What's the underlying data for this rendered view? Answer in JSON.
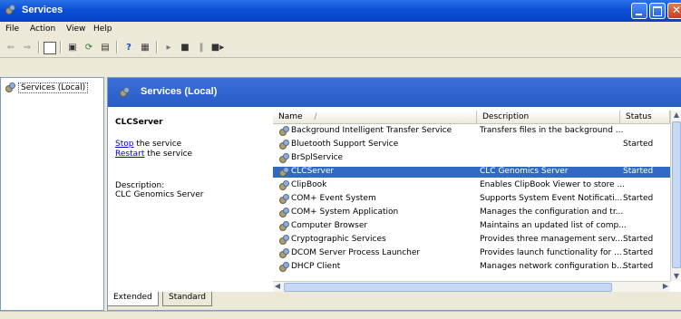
{
  "window": {
    "title": "Services"
  },
  "menu": [
    "File",
    "Action",
    "View",
    "Help"
  ],
  "toolbar": {
    "icons": [
      "back-icon",
      "forward-icon",
      "show-hide-tree-icon",
      "properties-icon",
      "refresh-icon",
      "export-list-icon",
      "help-icon",
      "console-icon",
      "start-icon",
      "stop-icon",
      "pause-icon",
      "restart-icon"
    ]
  },
  "tree": {
    "root": "Services (Local)"
  },
  "header": {
    "title": "Services (Local)"
  },
  "detail": {
    "service_name": "CLCServer",
    "stop_link": "Stop",
    "stop_suffix": " the service",
    "restart_link": "Restart",
    "restart_suffix": " the service",
    "description_label": "Description:",
    "description_text": "CLC Genomics Server"
  },
  "columns": {
    "name": "Name",
    "sort": "/",
    "description": "Description",
    "status": "Status"
  },
  "services": [
    {
      "name": "Background Intelligent Transfer Service",
      "description": "Transfers files in the background ...",
      "status": "",
      "selected": false
    },
    {
      "name": "Bluetooth Support Service",
      "description": "",
      "status": "Started",
      "selected": false
    },
    {
      "name": "BrSplService",
      "description": "",
      "status": "",
      "selected": false
    },
    {
      "name": "CLCServer",
      "description": "CLC Genomics Server",
      "status": "Started",
      "selected": true
    },
    {
      "name": "ClipBook",
      "description": "Enables ClipBook Viewer to store ...",
      "status": "",
      "selected": false
    },
    {
      "name": "COM+ Event System",
      "description": "Supports System Event Notificati...",
      "status": "Started",
      "selected": false
    },
    {
      "name": "COM+ System Application",
      "description": "Manages the configuration and tr...",
      "status": "",
      "selected": false
    },
    {
      "name": "Computer Browser",
      "description": "Maintains an updated list of comp...",
      "status": "",
      "selected": false
    },
    {
      "name": "Cryptographic Services",
      "description": "Provides three management serv...",
      "status": "Started",
      "selected": false
    },
    {
      "name": "DCOM Server Process Launcher",
      "description": "Provides launch functionality for ...",
      "status": "Started",
      "selected": false
    },
    {
      "name": "DHCP Client",
      "description": "Manages network configuration b...",
      "status": "Started",
      "selected": false
    }
  ],
  "tabs": [
    "Extended",
    "Standard"
  ],
  "colors": {
    "titlebar": "#0a4fd8",
    "header": "#2a5cc8",
    "selection": "#316ac5",
    "link": "#0000cc"
  }
}
